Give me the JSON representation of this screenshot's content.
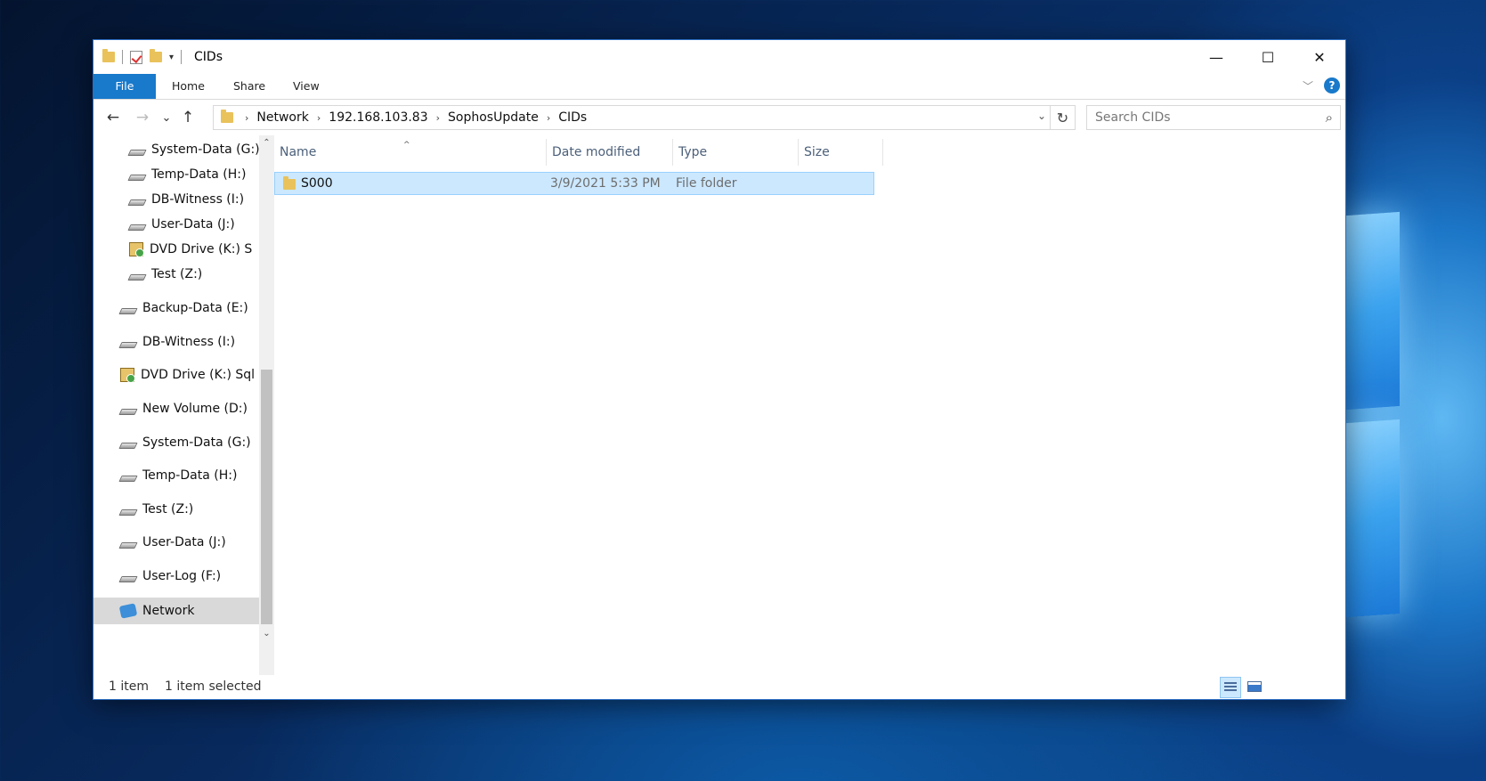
{
  "window": {
    "title": "CIDs",
    "caption": {
      "minimize": "—",
      "maximize": "☐",
      "close": "✕"
    }
  },
  "ribbon": {
    "tabs": [
      "File",
      "Home",
      "Share",
      "View"
    ],
    "help_label": "?",
    "expand_icon": "chevron-down-icon"
  },
  "navigation": {
    "back": "←",
    "forward": "→",
    "recent": "⌄",
    "up": "↑",
    "breadcrumbs": [
      "Network",
      "192.168.103.83",
      "SophosUpdate",
      "CIDs"
    ],
    "separator": "›",
    "address_dropdown": "⌄",
    "refresh": "↻",
    "search_placeholder": "Search CIDs",
    "search_icon": "⌕"
  },
  "nav_pane": {
    "items": [
      {
        "label": "System-Data (G:)",
        "icon": "drive-icon"
      },
      {
        "label": "Temp-Data (H:)",
        "icon": "drive-icon"
      },
      {
        "label": "DB-Witness (I:)",
        "icon": "drive-icon"
      },
      {
        "label": "User-Data (J:)",
        "icon": "drive-icon"
      },
      {
        "label": "DVD Drive (K:) S",
        "icon": "dvd-drive-icon"
      },
      {
        "label": "Test (Z:)",
        "icon": "drive-icon"
      },
      {
        "label": "Backup-Data (E:)",
        "icon": "drive-icon"
      },
      {
        "label": "DB-Witness (I:)",
        "icon": "drive-icon"
      },
      {
        "label": "DVD Drive (K:) Sql",
        "icon": "dvd-drive-icon"
      },
      {
        "label": "New Volume (D:)",
        "icon": "drive-icon"
      },
      {
        "label": "System-Data (G:)",
        "icon": "drive-icon"
      },
      {
        "label": "Temp-Data (H:)",
        "icon": "drive-icon"
      },
      {
        "label": "Test (Z:)",
        "icon": "drive-icon"
      },
      {
        "label": "User-Data (J:)",
        "icon": "drive-icon"
      },
      {
        "label": "User-Log (F:)",
        "icon": "drive-icon"
      },
      {
        "label": "Network",
        "icon": "network-icon"
      }
    ],
    "scroll_up": "⌃",
    "scroll_down": "⌄"
  },
  "file_list": {
    "columns": [
      "Name",
      "Date modified",
      "Type",
      "Size"
    ],
    "sort_indicator": "^",
    "rows": [
      {
        "name": "S000",
        "date": "3/9/2021 5:33 PM",
        "type": "File folder",
        "size": ""
      }
    ]
  },
  "status": {
    "count": "1 item",
    "selection": "1 item selected"
  },
  "colors": {
    "accent": "#1979ca",
    "selection": "#cce8ff"
  }
}
